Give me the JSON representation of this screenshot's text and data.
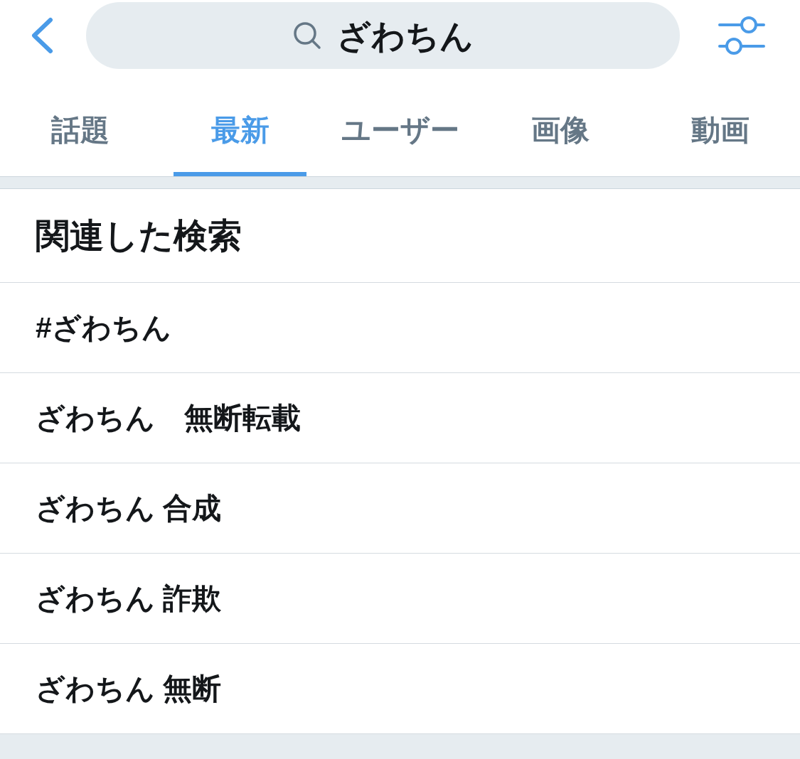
{
  "search": {
    "value": "ざわちん"
  },
  "tabs": [
    {
      "label": "話題",
      "selected": false
    },
    {
      "label": "最新",
      "selected": true
    },
    {
      "label": "ユーザー",
      "selected": false
    },
    {
      "label": "画像",
      "selected": false
    },
    {
      "label": "動画",
      "selected": false
    }
  ],
  "related_searches": {
    "title": "関連した検索",
    "items": [
      "#ざわちん",
      "ざわちん　無断転載",
      "ざわちん 合成",
      "ざわちん 詐欺",
      "ざわちん 無断"
    ]
  }
}
